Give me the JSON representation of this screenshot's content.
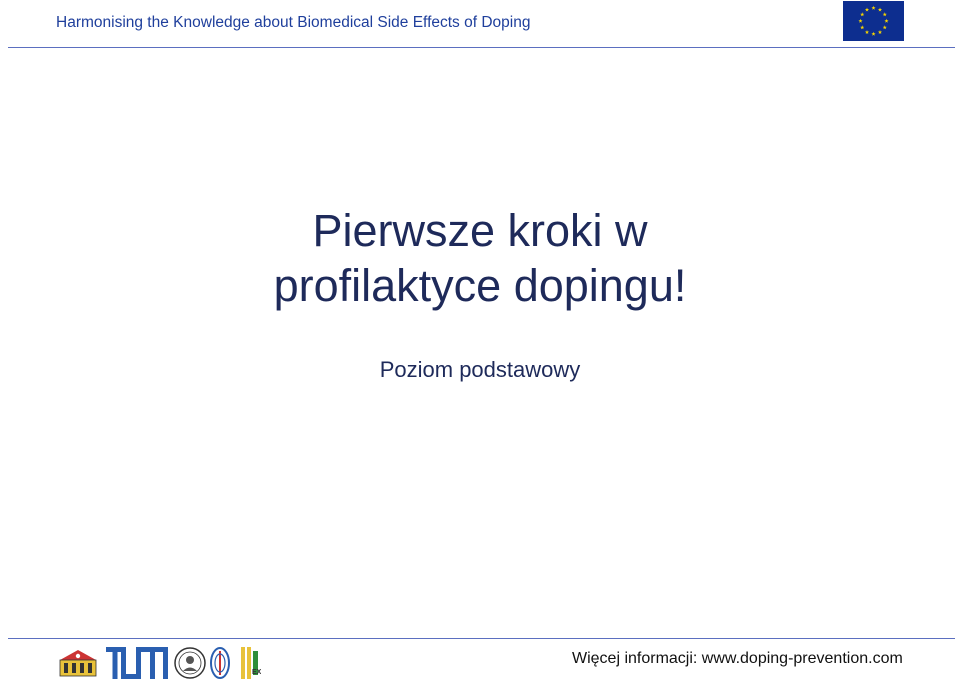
{
  "header": {
    "title": "Harmonising the Knowledge about Biomedical Side Effects of Doping",
    "flag_icon": "eu-flag-icon",
    "flag_colors": {
      "background": "#0d2e8f",
      "stars": "#f5d400"
    }
  },
  "slide": {
    "title_line1": "Pierwsze kroki w",
    "title_line2": "profilaktyce dopingu!",
    "subtitle": "Poziom podstawowy"
  },
  "footer": {
    "logo_icons": [
      "university-crest-logo-icon",
      "tum-logo-icon",
      "round-seal-logo-icon",
      "oval-emblem-logo-icon",
      "ex-logo-icon"
    ],
    "info_text": "Więcej informacji: www.doping-prevention.com"
  },
  "colors": {
    "header_text": "#1f3f9c",
    "title_text": "#1e2a5a",
    "rule": "#5b6fc0",
    "tum_blue": "#2a5fb0"
  }
}
